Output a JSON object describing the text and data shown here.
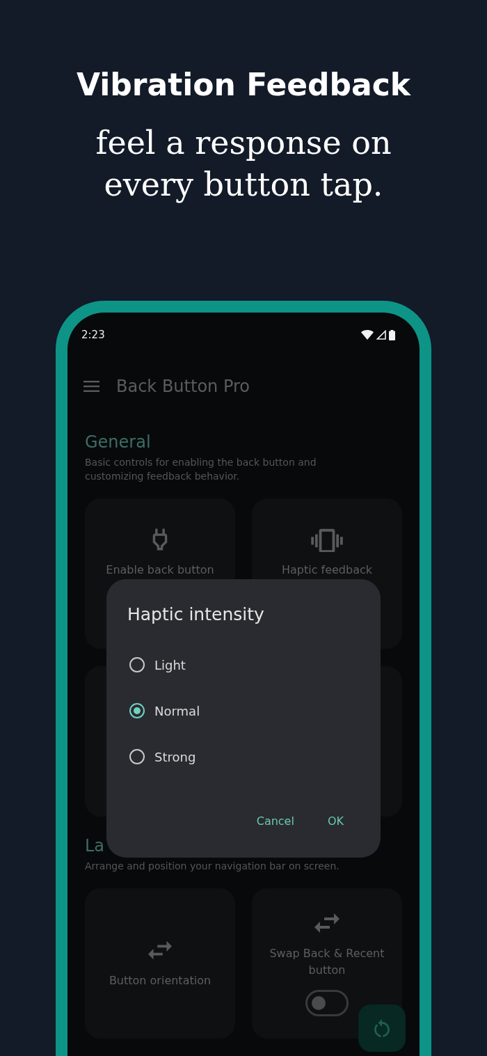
{
  "headline": {
    "title": "Vibration Feedback",
    "subtitle": "feel a response on every button tap."
  },
  "status_bar": {
    "time": "2:23"
  },
  "app_bar": {
    "title": "Back Button Pro"
  },
  "sections": [
    {
      "title": "General",
      "description": "Basic controls for enabling the back button and customizing feedback behavior.",
      "cards": [
        {
          "kind": "feature",
          "label": "Enable back button"
        },
        {
          "kind": "feature",
          "label": "Haptic feedback"
        },
        {
          "kind": "blank"
        },
        {
          "kind": "blank"
        }
      ]
    },
    {
      "title": "La",
      "description": "Arrange and position your navigation bar on screen.",
      "cards": [
        {
          "kind": "feature",
          "label": "Button orientation"
        },
        {
          "kind": "switch",
          "label": "Swap Back & Recent button",
          "on": false
        }
      ]
    }
  ],
  "dialog": {
    "title": "Haptic intensity",
    "options": [
      {
        "label": "Light",
        "selected": false
      },
      {
        "label": "Normal",
        "selected": true
      },
      {
        "label": "Strong",
        "selected": false
      }
    ],
    "buttons": [
      "Cancel",
      "OK"
    ]
  }
}
